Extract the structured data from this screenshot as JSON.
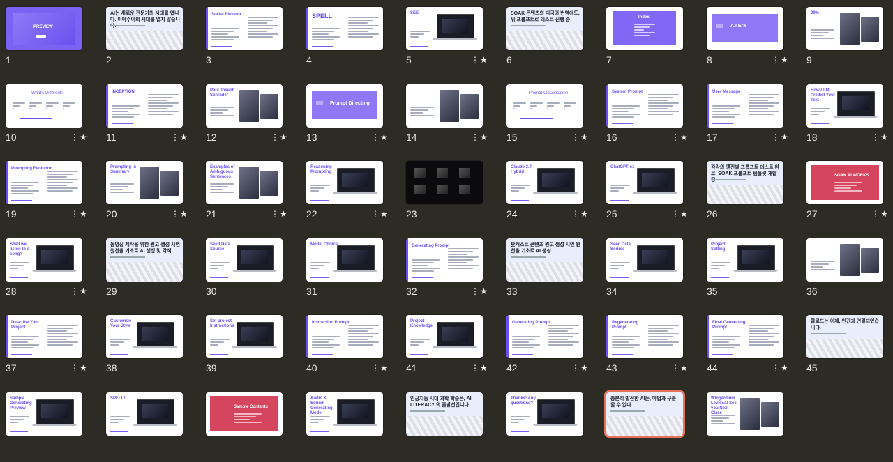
{
  "accent": "#6b4ef6",
  "slides": [
    {
      "n": "1",
      "star": "",
      "layout": "purple",
      "title": "PREVIEW"
    },
    {
      "n": "2",
      "star": "",
      "layout": "banner",
      "title": "AI는 새로운 전문가의 시대를 엽니다. 이야수이의 시대를 열지 않습니다."
    },
    {
      "n": "3",
      "star": "",
      "layout": "text-left",
      "title": "Social Elevator"
    },
    {
      "n": "4",
      "star": "",
      "layout": "text-left",
      "title": "SPELL"
    },
    {
      "n": "5",
      "star": "★",
      "layout": "laptop",
      "title": "SEE"
    },
    {
      "n": "6",
      "star": "",
      "layout": "banner",
      "title": "SOAK 콘텐츠의 디국어 번역에도, 위 프롬프트로 테스트 진행 중"
    },
    {
      "n": "7",
      "star": "",
      "layout": "index",
      "title": "Index"
    },
    {
      "n": "8",
      "star": "★",
      "layout": "section",
      "title": "A.I Era"
    },
    {
      "n": "9",
      "star": "",
      "layout": "photo",
      "title": "99%"
    },
    {
      "n": "10",
      "star": "★",
      "layout": "text-center",
      "title": "What's Different?"
    },
    {
      "n": "11",
      "star": "★",
      "layout": "text-left",
      "title": "INCEPTION"
    },
    {
      "n": "12",
      "star": "★",
      "layout": "photo",
      "title": "Paul Joseph Schrader"
    },
    {
      "n": "13",
      "star": "★",
      "layout": "section",
      "title": "Prompt Directing"
    },
    {
      "n": "14",
      "star": "★",
      "layout": "photo",
      "title": ""
    },
    {
      "n": "15",
      "star": "★",
      "layout": "text-center",
      "title": "Prompt Classification"
    },
    {
      "n": "16",
      "star": "★",
      "layout": "text-left",
      "title": "System Prompt"
    },
    {
      "n": "17",
      "star": "★",
      "layout": "text-left",
      "title": "User Message"
    },
    {
      "n": "18",
      "star": "★",
      "layout": "laptop",
      "title": "How LLM Predict Your Text"
    },
    {
      "n": "19",
      "star": "★",
      "layout": "text-left",
      "title": "Prompting Evolution"
    },
    {
      "n": "20",
      "star": "★",
      "layout": "photo",
      "title": "Prompting in Summary"
    },
    {
      "n": "21",
      "star": "★",
      "layout": "photo",
      "title": "Examples of Ambiguous Sentences"
    },
    {
      "n": "22",
      "star": "★",
      "layout": "laptop",
      "title": "Reasoning Prompting"
    },
    {
      "n": "23",
      "star": "",
      "layout": "dark",
      "title": ""
    },
    {
      "n": "24",
      "star": "★",
      "layout": "laptop",
      "title": "Claude 3.7 Hybrid"
    },
    {
      "n": "25",
      "star": "★",
      "layout": "laptop",
      "title": "ChatGPT o1"
    },
    {
      "n": "26",
      "star": "",
      "layout": "banner",
      "title": "각각의 엔진별 프롬프트 테스트 완료, SOAK 프롬프트 템플릿 개발 중"
    },
    {
      "n": "27",
      "star": "★",
      "layout": "red",
      "title": "SOAK AI WORKS"
    },
    {
      "n": "28",
      "star": "★",
      "layout": "laptop",
      "title": "Shall we listen to a song?"
    },
    {
      "n": "29",
      "star": "",
      "layout": "banner",
      "title": "동영상 제작을 위한 원고 생성 시연 원천을 기초로 AI 생성 및 각색"
    },
    {
      "n": "30",
      "star": "",
      "layout": "laptop",
      "title": "Seed Data Source"
    },
    {
      "n": "31",
      "star": "",
      "layout": "laptop",
      "title": "Model Choice"
    },
    {
      "n": "32",
      "star": "★",
      "layout": "text-left",
      "title": "Generating Prompt"
    },
    {
      "n": "33",
      "star": "",
      "layout": "banner",
      "title": "팟캐스트 콘텐츠 원고 생성 시연 원천을 기초로 AI 생성"
    },
    {
      "n": "34",
      "star": "",
      "layout": "laptop",
      "title": "Seed Data Source"
    },
    {
      "n": "35",
      "star": "",
      "layout": "laptop",
      "title": "Project Setting"
    },
    {
      "n": "36",
      "star": "",
      "layout": "photo",
      "title": ""
    },
    {
      "n": "37",
      "star": "★",
      "layout": "text-left",
      "title": "Describe Your Project"
    },
    {
      "n": "38",
      "star": "",
      "layout": "laptop",
      "title": "Customize Your Style"
    },
    {
      "n": "39",
      "star": "",
      "layout": "laptop",
      "title": "Set project Instructions"
    },
    {
      "n": "40",
      "star": "★",
      "layout": "text-left",
      "title": "Instruction Prompt"
    },
    {
      "n": "41",
      "star": "★",
      "layout": "laptop",
      "title": "Project Knowledge"
    },
    {
      "n": "42",
      "star": "★",
      "layout": "text-left",
      "title": "Generating Prompt"
    },
    {
      "n": "43",
      "star": "★",
      "layout": "text-left",
      "title": "Regenerating Prompt"
    },
    {
      "n": "44",
      "star": "★",
      "layout": "text-left",
      "title": "Final Generating Prompt"
    },
    {
      "n": "45",
      "star": "",
      "layout": "banner",
      "title": "클로드는 이제, 인간과 연결되었습니다."
    },
    {
      "n": "",
      "star": "",
      "layout": "laptop",
      "title": "Sample Generating Preview"
    },
    {
      "n": "",
      "star": "",
      "layout": "laptop",
      "title": "SPELL!"
    },
    {
      "n": "",
      "star": "",
      "layout": "red",
      "title": "Sample Contents"
    },
    {
      "n": "",
      "star": "",
      "layout": "laptop",
      "title": "Audio & Sound Generating Model"
    },
    {
      "n": "",
      "star": "",
      "layout": "banner",
      "title": "인공지능 시대 과학 학습은, AI LITERACY 의 출발선입니다."
    },
    {
      "n": "",
      "star": "",
      "layout": "laptop",
      "title": "Thanks! Any questions?"
    },
    {
      "n": "",
      "star": "",
      "layout": "banner",
      "title": "충분히 발전한 AI는, 마법과 구분할 수 없다."
    },
    {
      "n": "",
      "star": "",
      "layout": "photo",
      "title": "Wingardium Leviosa! See you Next Class"
    }
  ]
}
